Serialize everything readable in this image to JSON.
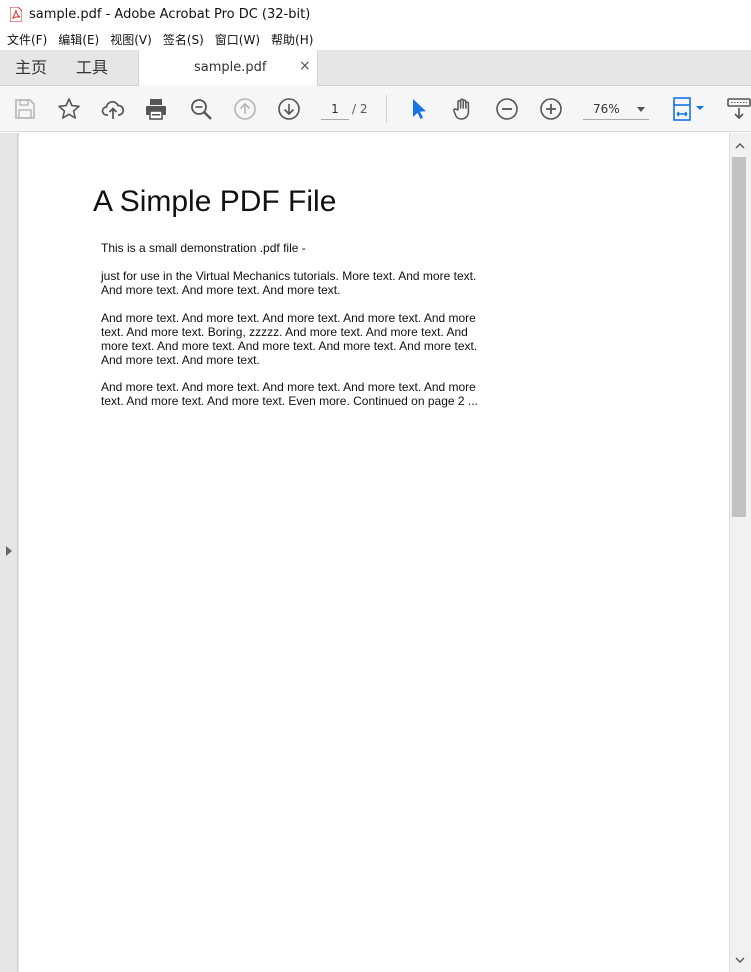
{
  "window": {
    "title": "sample.pdf - Adobe Acrobat Pro DC (32-bit)"
  },
  "menu": {
    "items": [
      "文件(F)",
      "编辑(E)",
      "视图(V)",
      "签名(S)",
      "窗口(W)",
      "帮助(H)"
    ]
  },
  "tabs": {
    "home": "主页",
    "tools": "工具",
    "document": "sample.pdf",
    "close": "×"
  },
  "toolbar": {
    "icons": [
      "save-icon",
      "bookmark-star-icon",
      "cloud-upload-icon",
      "print-icon",
      "zoom-search-icon",
      "page-up-icon",
      "page-down-icon",
      "select-cursor-icon",
      "hand-tool-icon",
      "zoom-out-icon",
      "zoom-in-icon",
      "fit-page-icon",
      "more-tools-icon"
    ],
    "page_current": "1",
    "page_total": "/ 2",
    "zoom": "76%"
  },
  "colors": {
    "accent_blue": "#1473e6",
    "toolbar_icon": "#555555",
    "disabled_icon": "#b5b5b5"
  },
  "document": {
    "heading": "A Simple PDF File",
    "paragraphs": [
      "This is a small demonstration .pdf file -",
      "just for use in the Virtual Mechanics tutorials. More text. And more text. And more text. And more text. And more text.",
      "And more text. And more text. And more text. And more text. And more text. And more text. Boring, zzzzz. And more text. And more text. And more text. And more text. And more text. And more text. And more text. And more text. And more text.",
      "And more text. And more text. And more text. And more text. And more text. And more text. And more text. Even more. Continued on page 2 ..."
    ]
  }
}
